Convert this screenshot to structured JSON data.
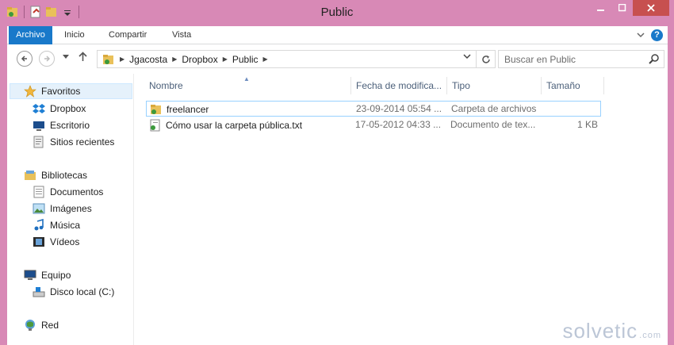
{
  "window": {
    "title": "Public",
    "buttons": {
      "minimize": "—",
      "maximize": "☐",
      "close": "✕"
    }
  },
  "ribbon": {
    "tabs": [
      "Archivo",
      "Inicio",
      "Compartir",
      "Vista"
    ],
    "help": "?"
  },
  "address": {
    "crumbs": [
      "Jgacosta",
      "Dropbox",
      "Public"
    ],
    "search_placeholder": "Buscar en Public"
  },
  "nav_pane": {
    "favorites": {
      "label": "Favoritos",
      "items": [
        "Dropbox",
        "Escritorio",
        "Sitios recientes"
      ]
    },
    "libraries": {
      "label": "Bibliotecas",
      "items": [
        "Documentos",
        "Imágenes",
        "Música",
        "Vídeos"
      ]
    },
    "computer": {
      "label": "Equipo",
      "items": [
        "Disco local (C:)"
      ]
    },
    "network": {
      "label": "Red"
    }
  },
  "columns": [
    "Nombre",
    "Fecha de modifica...",
    "Tipo",
    "Tamaño"
  ],
  "files": [
    {
      "name": "freelancer",
      "date": "23-09-2014 05:54 ...",
      "type": "Carpeta de archivos",
      "size": "",
      "icon": "folder-icon"
    },
    {
      "name": "Cómo usar la carpeta pública.txt",
      "date": "17-05-2012 04:33 ...",
      "type": "Documento de tex...",
      "size": "1 KB",
      "icon": "text-file-icon"
    }
  ],
  "watermark": {
    "brand": "solvetic",
    "domain": ".com"
  }
}
